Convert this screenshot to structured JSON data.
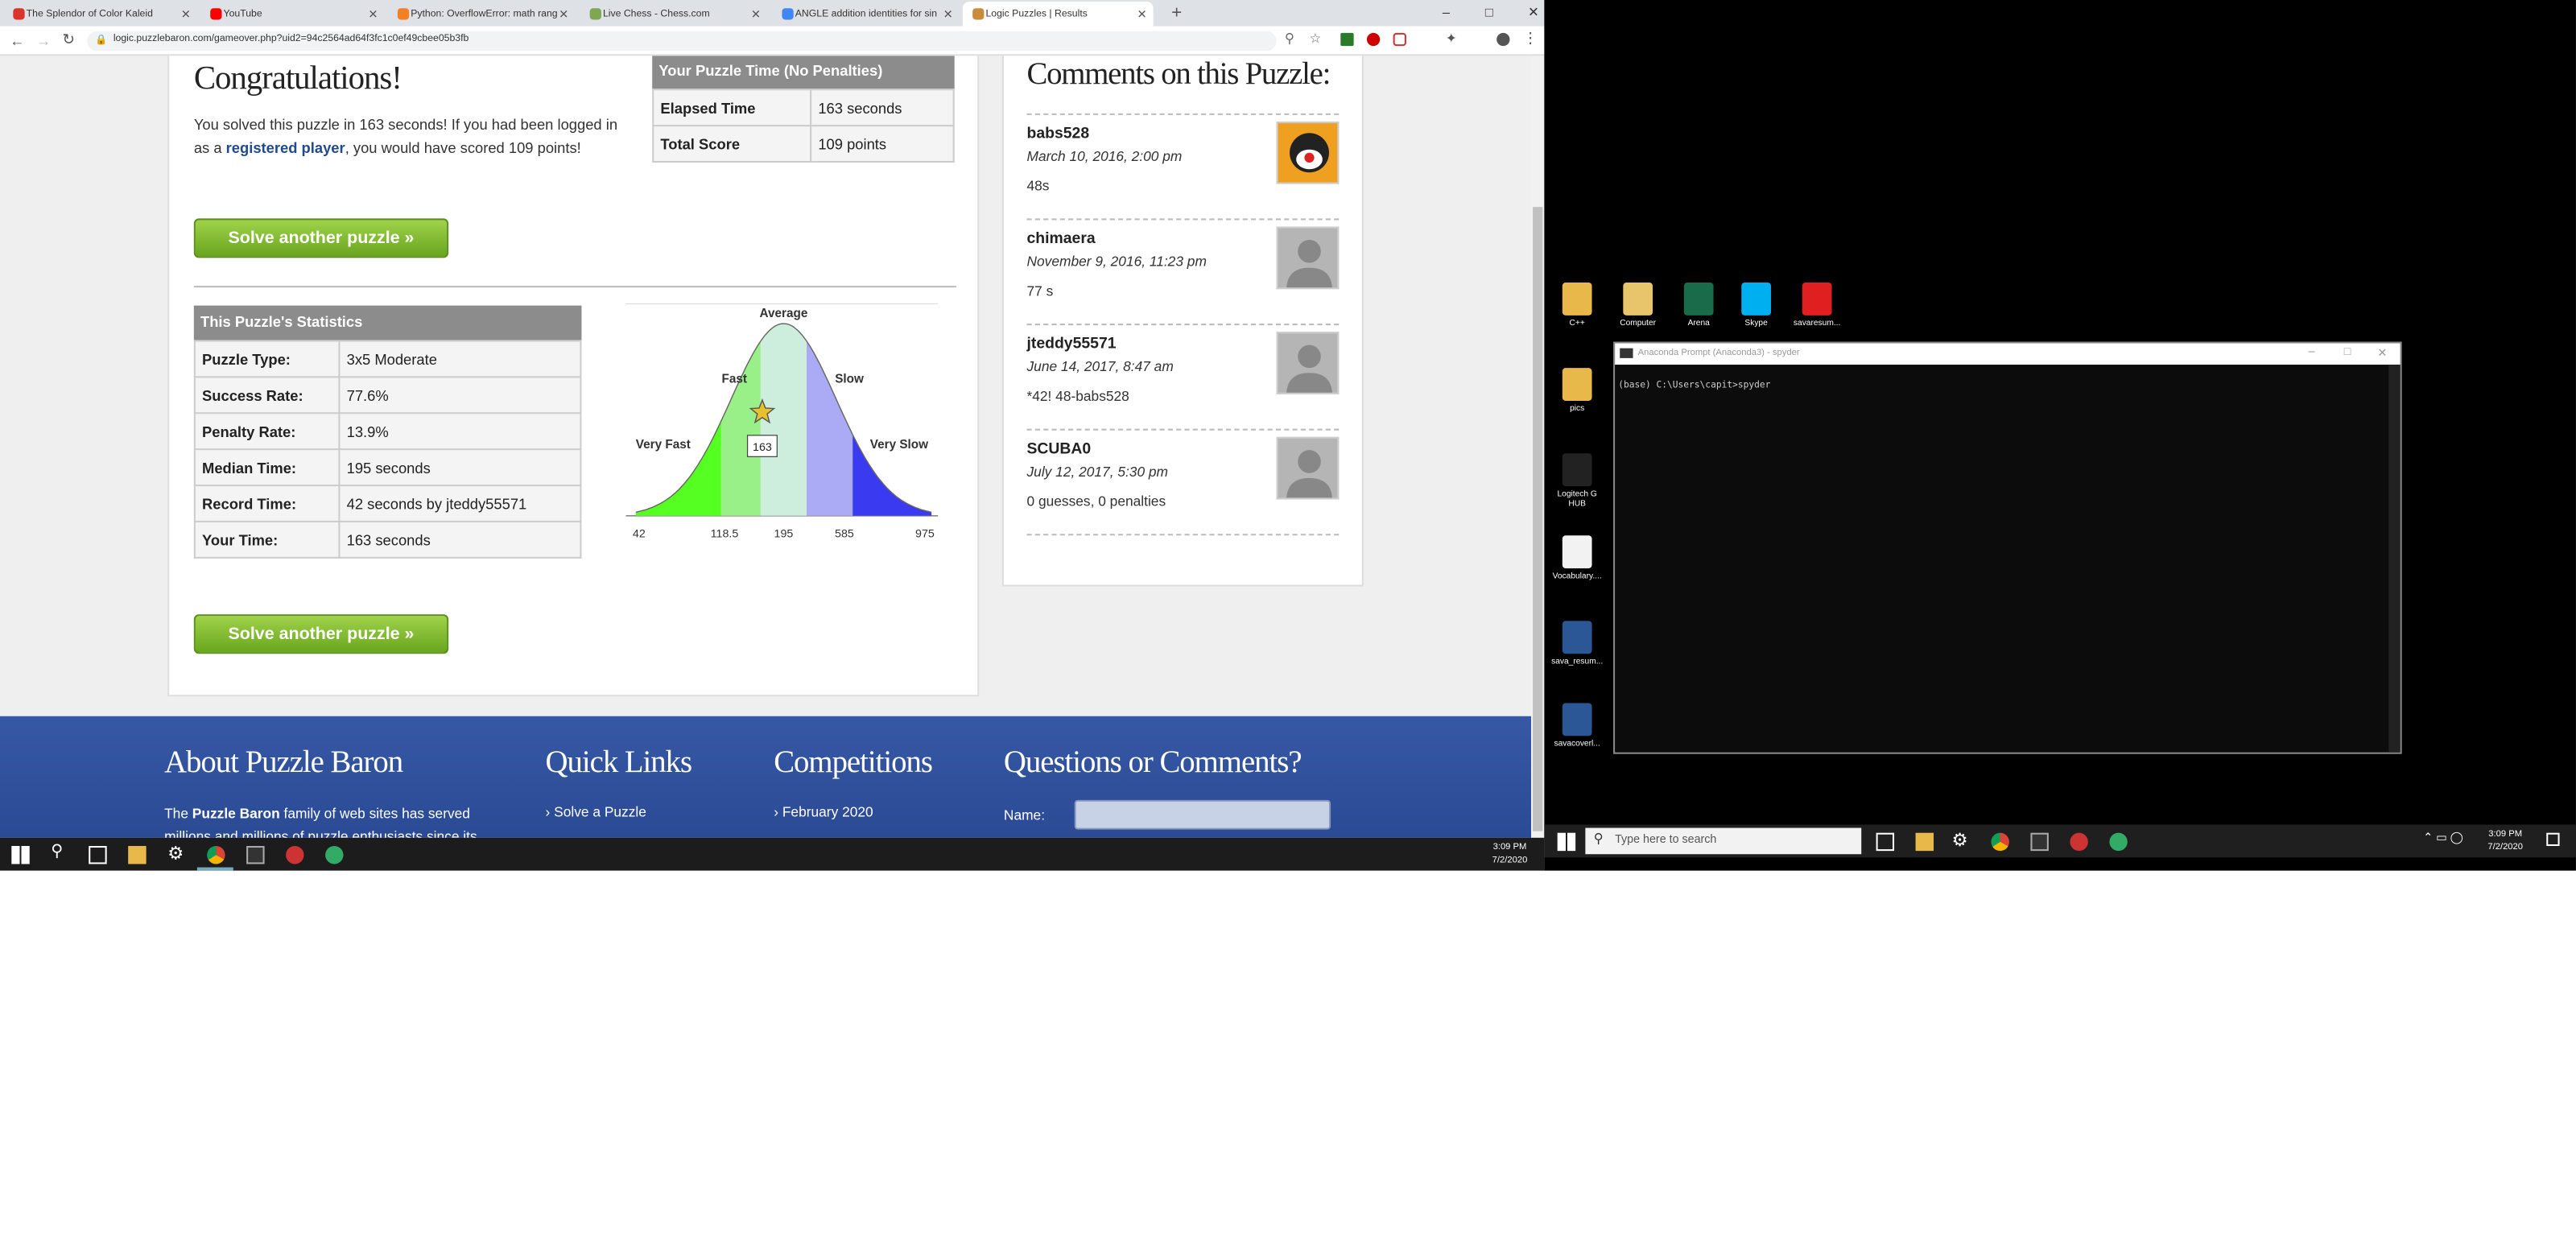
{
  "browser": {
    "tabs": [
      {
        "label": "The Splendor of Color Kaleid",
        "color": "#d9352a"
      },
      {
        "label": "YouTube",
        "color": "#ff0000"
      },
      {
        "label": "Python: OverflowError: math rang",
        "color": "#f48024"
      },
      {
        "label": "Live Chess - Chess.com",
        "color": "#7fa650"
      },
      {
        "label": "ANGLE addition identities for sin",
        "color": "#4285f4"
      },
      {
        "label": "Logic Puzzles | Results",
        "color": "#c98c3c"
      }
    ],
    "url": "logic.puzzlebaron.com/gameover.php?uid2=94c2564ad64f3fc1c0ef49cbee05b3fb"
  },
  "congrats": {
    "title": "Congratulations!",
    "msg1": "You solved this puzzle in 163 seconds! If you had been logged in as a ",
    "link": "registered player",
    "msg2": ", you would have scored 109 points!"
  },
  "time_table": {
    "header": "Your Puzzle Time (No Penalties)",
    "rows": [
      {
        "k": "Elapsed Time",
        "v": "163 seconds"
      },
      {
        "k": "Total Score",
        "v": "109 points"
      }
    ]
  },
  "solve_label": "Solve another puzzle »",
  "stats": {
    "header": "This Puzzle's Statistics",
    "rows": [
      {
        "k": "Puzzle Type:",
        "v": "3x5 Moderate"
      },
      {
        "k": "Success Rate:",
        "v": "77.6%"
      },
      {
        "k": "Penalty Rate:",
        "v": "13.9%"
      },
      {
        "k": "Median Time:",
        "v": "195 seconds"
      },
      {
        "k": "Record Time:",
        "v": "42 seconds by jteddy55571"
      },
      {
        "k": "Your Time:",
        "v": "163 seconds"
      }
    ]
  },
  "chart_data": {
    "type": "area",
    "title": "",
    "bands": [
      "Very Fast",
      "Fast",
      "Average",
      "Slow",
      "Very Slow"
    ],
    "band_colors": [
      "#55ff22",
      "#99f088",
      "#cdeedd",
      "#aaaaf5",
      "#3a3af0"
    ],
    "x_ticks": [
      "42",
      "118.5",
      "195",
      "585",
      "975"
    ],
    "marker": {
      "label": "163",
      "value": 163
    }
  },
  "comments": {
    "title": "Comments on this Puzzle:",
    "items": [
      {
        "name": "babs528",
        "date": "March 10, 2016, 2:00 pm",
        "text": "48s"
      },
      {
        "name": "chimaera",
        "date": "November 9, 2016, 11:23 pm",
        "text": "77 s"
      },
      {
        "name": "jteddy55571",
        "date": "June 14, 2017, 8:47 am",
        "text": "*42! 48-babs528"
      },
      {
        "name": "SCUBA0",
        "date": "July 12, 2017, 5:30 pm",
        "text": "0 guesses, 0 penalties"
      }
    ]
  },
  "footer": {
    "about": "About Puzzle Baron",
    "about_text_pre": "The ",
    "about_bold": "Puzzle Baron",
    "about_text": " family of web sites has served millions and millions of puzzle enthusiasts since its",
    "quick": "Quick Links",
    "quick_item": "Solve a Puzzle",
    "comp": "Competitions",
    "comp_item": "February 2020",
    "qc": "Questions or Comments?",
    "name_label": "Name:"
  },
  "taskbar_left": {
    "time": "3:09 PM",
    "date": "7/2/2020"
  },
  "desktop": {
    "icons": [
      {
        "label": "C++",
        "color": "#e8b84a"
      },
      {
        "label": "Computer",
        "color": "#e8c46a"
      },
      {
        "label": "Arena",
        "color": "#1a6b4a"
      },
      {
        "label": "Skype",
        "color": "#00aff0"
      },
      {
        "label": "savaresum...",
        "color": "#e02020"
      },
      {
        "label": "pics",
        "color": "#e8b84a"
      },
      {
        "label": "Logitech G HUB",
        "color": "#222222"
      },
      {
        "label": "Vocabulary....",
        "color": "#f2f2f2"
      },
      {
        "label": "sava_resum...",
        "color": "#2b5797"
      },
      {
        "label": "savacoverl...",
        "color": "#2b5797"
      }
    ],
    "console_title": "Anaconda Prompt (Anaconda3) - spyder",
    "console_line": "(base) C:\\Users\\capit>spyder",
    "search": "Type here to search",
    "time": "3:09 PM",
    "date": "7/2/2020"
  }
}
